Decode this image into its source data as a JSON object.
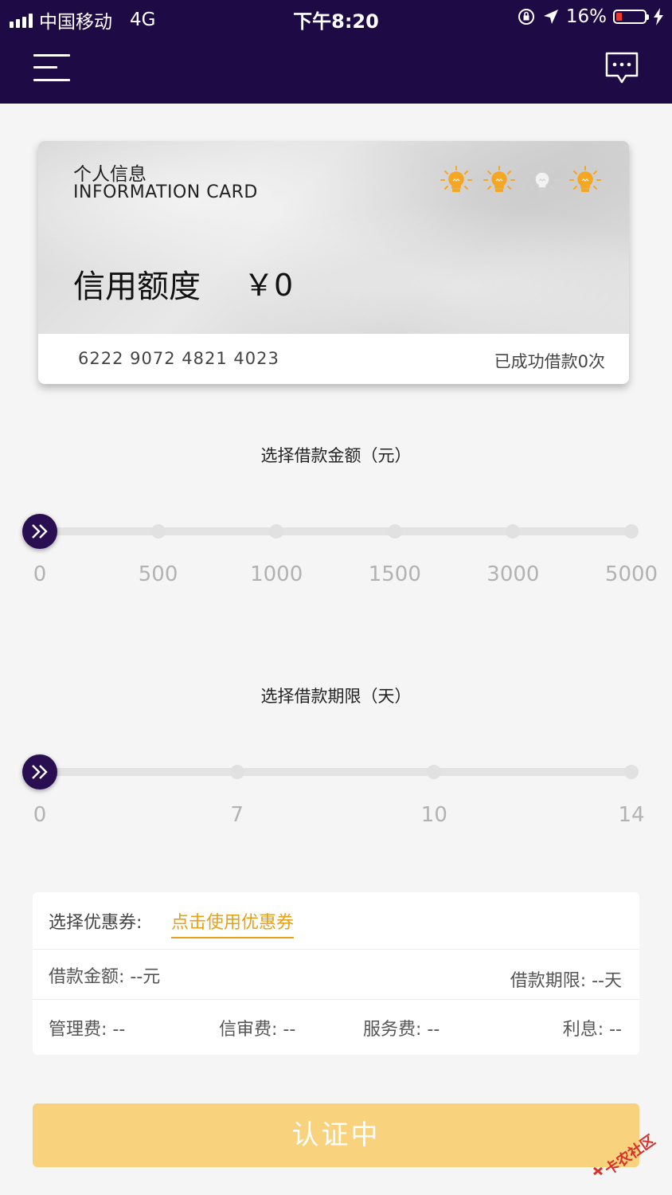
{
  "status_bar": {
    "carrier": "中国移动",
    "network": "4G",
    "time": "下午8:20",
    "battery": "16%"
  },
  "nav": {
    "menu_icon": "hamburger-menu-icon",
    "message_icon": "chat-bubble-icon"
  },
  "card": {
    "title_cn": "个人信息",
    "title_en": "INFORMATION CARD",
    "bulbs_lit": [
      true,
      true,
      false,
      true
    ],
    "credit_label": "信用额度",
    "credit_value": "￥0",
    "card_number": "6222 9072 4821 4023",
    "loan_count_text": "已成功借款0次"
  },
  "amount_slider": {
    "title": "选择借款金额（元）",
    "ticks": [
      "0",
      "500",
      "1000",
      "1500",
      "3000",
      "5000"
    ],
    "selected_index": 0
  },
  "term_slider": {
    "title": "选择借款期限（天）",
    "ticks": [
      "0",
      "7",
      "10",
      "14"
    ],
    "selected_index": 0
  },
  "info": {
    "coupon_label": "选择优惠券:",
    "coupon_link": "点击使用优惠券",
    "loan_amount": "借款金额: --元",
    "loan_term": "借款期限: --天",
    "management_fee": "管理费: --",
    "review_fee": "信审费: --",
    "service_fee": "服务费: --",
    "interest": "利息: --"
  },
  "submit_button": "认证中",
  "watermark_text": "卡农社区",
  "colors": {
    "nav_bg": "#1e0b45",
    "handle": "#2a0e52",
    "accent": "#e6a117",
    "button_bg": "#f8d27c",
    "bulb_lit": "#f5a623",
    "bulb_off": "#d0d0d0"
  }
}
